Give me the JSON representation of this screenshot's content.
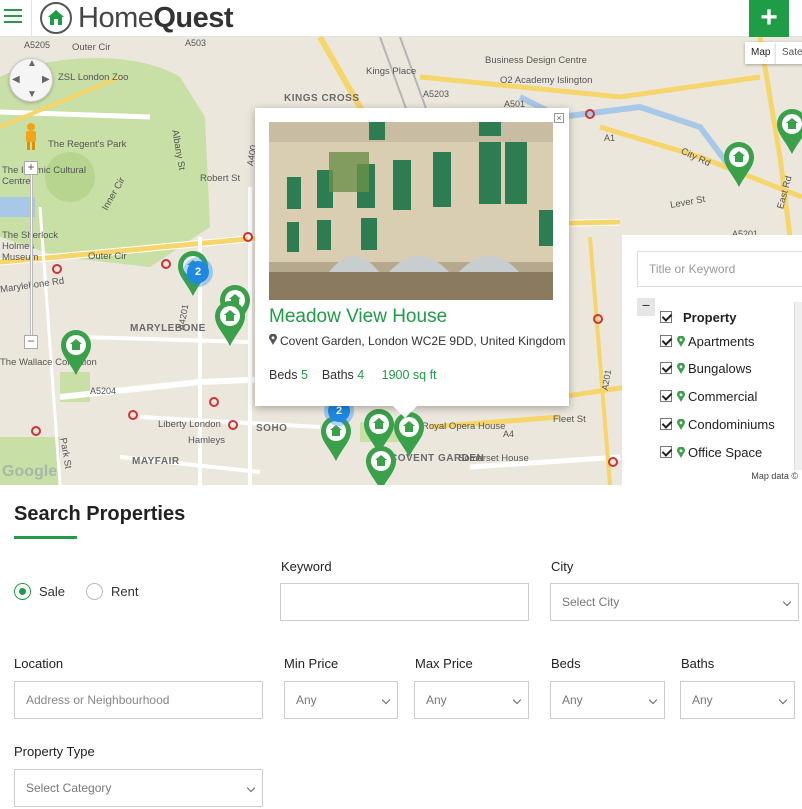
{
  "header": {
    "brand_light": "Home",
    "brand_bold": "Quest",
    "add_label": "+"
  },
  "map": {
    "map_type_map": "Map",
    "map_type_satellite": "Satel",
    "footer": "Map data ©",
    "google": "Google",
    "labels": {
      "a5205": "A5205",
      "outer_cir_top": "Outer Cir",
      "a503": "A503",
      "zoo": "ZSL London Zoo",
      "kings_place": "Kings Place",
      "business_design": "Business Design Centre",
      "o2_academy": "O2 Academy Islington",
      "kings_cross": "KINGS CROSS",
      "a5203": "A5203",
      "a501": "A501",
      "regents_park": "The Regent's Park",
      "albany": "Albany St",
      "islamic": "The Islamic Cultural Centre",
      "robert_st": "Robert St",
      "a400": "A400",
      "inner_cir": "Inner Cir",
      "sherlock": "The Sherlock Holmes Museum",
      "outer_cir_left": "Outer Cir",
      "marylebone_rd": "Marylebone Rd",
      "a4201": "A4201",
      "marylebone": "MARYLEBONE",
      "wallace": "The Wallace Collection",
      "a5204": "A5204",
      "liberty": "Liberty London",
      "hamleys": "Hamleys",
      "soho": "SOHO",
      "mayfair": "MAYFAIR",
      "park_st": "Park St",
      "city_rd": "City Rd",
      "a1": "A1",
      "east_rd": "East Rd",
      "lever_st": "Lever St",
      "a5201": "A5201",
      "royal_opera": "Royal Opera House",
      "covent_garden": "COVENT GARDEN",
      "somerset": "Somerset House",
      "fleet_st": "Fleet St",
      "a4": "A4",
      "a201": "A201"
    },
    "clusters": [
      "2",
      "2"
    ]
  },
  "info_window": {
    "title": "Meadow View House",
    "address": "Covent Garden, London WC2E 9DD, United Kingdom",
    "beds_label": "Beds",
    "beds_value": "5",
    "baths_label": "Baths",
    "baths_value": "4",
    "area": "1900 sq ft"
  },
  "category_panel": {
    "search_placeholder": "Title or Keyword",
    "collapse": "−",
    "root": "Property",
    "items": [
      "Apartments",
      "Bungalows",
      "Commercial",
      "Condominiums",
      "Office Space"
    ]
  },
  "search": {
    "title": "Search Properties",
    "sale_label": "Sale",
    "rent_label": "Rent",
    "keyword_label": "Keyword",
    "keyword_value": "",
    "city_label": "City",
    "city_value": "Select City",
    "location_label": "Location",
    "location_placeholder": "Address or Neighbourhood",
    "min_price_label": "Min Price",
    "min_price_value": "Any",
    "max_price_label": "Max Price",
    "max_price_value": "Any",
    "beds_label": "Beds",
    "beds_value": "Any",
    "baths_label": "Baths",
    "baths_value": "Any",
    "property_type_label": "Property Type",
    "property_type_value": "Select Category"
  },
  "colors": {
    "brand_green": "#1f9c46",
    "cluster_blue": "#1e88e5"
  }
}
